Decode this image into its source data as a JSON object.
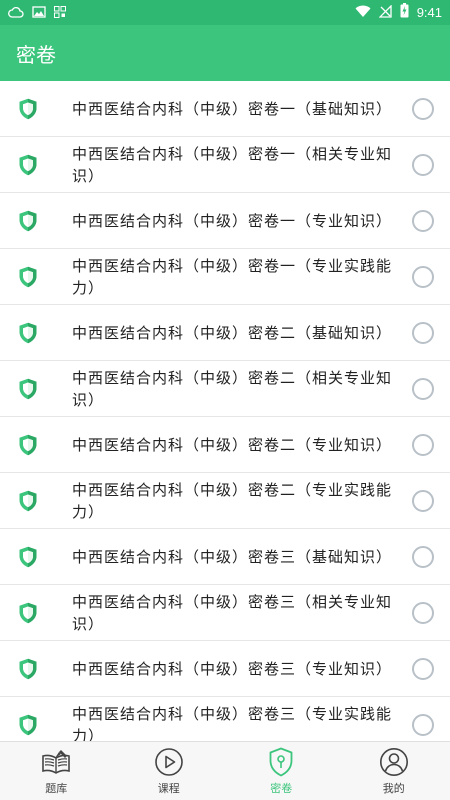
{
  "status_bar": {
    "time": "9:41",
    "icons": [
      "cloud-icon",
      "image-icon",
      "qr-icon",
      "wifi-icon",
      "signal-off-icon",
      "battery-charging-icon"
    ]
  },
  "app_bar": {
    "title": "密卷"
  },
  "items": [
    {
      "label": "中西医结合内科（中级）密卷一（基础知识）"
    },
    {
      "label": "中西医结合内科（中级）密卷一（相关专业知识）"
    },
    {
      "label": "中西医结合内科（中级）密卷一（专业知识）"
    },
    {
      "label": "中西医结合内科（中级）密卷一（专业实践能力）"
    },
    {
      "label": "中西医结合内科（中级）密卷二（基础知识）"
    },
    {
      "label": "中西医结合内科（中级）密卷二（相关专业知识）"
    },
    {
      "label": "中西医结合内科（中级）密卷二（专业知识）"
    },
    {
      "label": "中西医结合内科（中级）密卷二（专业实践能力）"
    },
    {
      "label": "中西医结合内科（中级）密卷三（基础知识）"
    },
    {
      "label": "中西医结合内科（中级）密卷三（相关专业知识）"
    },
    {
      "label": "中西医结合内科（中级）密卷三（专业知识）"
    },
    {
      "label": "中西医结合内科（中级）密卷三（专业实践能力）"
    }
  ],
  "tabs": [
    {
      "label": "题库",
      "icon": "book-icon",
      "active": false
    },
    {
      "label": "课程",
      "icon": "play-icon",
      "active": false
    },
    {
      "label": "密卷",
      "icon": "shield-icon",
      "active": true
    },
    {
      "label": "我的",
      "icon": "user-icon",
      "active": false
    }
  ],
  "colors": {
    "accent": "#3cc57c",
    "status_bar": "#2eb872",
    "radio_border": "#b8c0c8"
  }
}
